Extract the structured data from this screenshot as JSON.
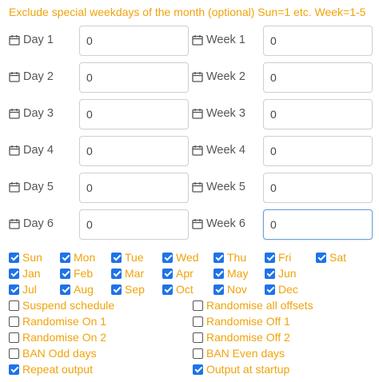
{
  "header": "Exclude special weekdays of the month (optional) Sun=1 etc. Week=1-5",
  "days": [
    {
      "label": "Day 1",
      "value": "0"
    },
    {
      "label": "Day 2",
      "value": "0"
    },
    {
      "label": "Day 3",
      "value": "0"
    },
    {
      "label": "Day 4",
      "value": "0"
    },
    {
      "label": "Day 5",
      "value": "0"
    },
    {
      "label": "Day 6",
      "value": "0"
    }
  ],
  "weeks": [
    {
      "label": "Week 1",
      "value": "0"
    },
    {
      "label": "Week 2",
      "value": "0"
    },
    {
      "label": "Week 3",
      "value": "0"
    },
    {
      "label": "Week 4",
      "value": "0"
    },
    {
      "label": "Week 5",
      "value": "0"
    },
    {
      "label": "Week 6",
      "value": "0"
    }
  ],
  "weekdays": [
    {
      "label": "Sun",
      "checked": true
    },
    {
      "label": "Mon",
      "checked": true
    },
    {
      "label": "Tue",
      "checked": true
    },
    {
      "label": "Wed",
      "checked": true
    },
    {
      "label": "Thu",
      "checked": true
    },
    {
      "label": "Fri",
      "checked": true
    },
    {
      "label": "Sat",
      "checked": true
    }
  ],
  "months_row1": [
    {
      "label": "Jan",
      "checked": true
    },
    {
      "label": "Feb",
      "checked": true
    },
    {
      "label": "Mar",
      "checked": true
    },
    {
      "label": "Apr",
      "checked": true
    },
    {
      "label": "May",
      "checked": true
    },
    {
      "label": "Jun",
      "checked": true
    }
  ],
  "months_row2": [
    {
      "label": "Jul",
      "checked": true
    },
    {
      "label": "Aug",
      "checked": true
    },
    {
      "label": "Sep",
      "checked": true
    },
    {
      "label": "Oct",
      "checked": true
    },
    {
      "label": "Nov",
      "checked": true
    },
    {
      "label": "Dec",
      "checked": true
    }
  ],
  "options": [
    {
      "label": "Suspend schedule",
      "checked": false
    },
    {
      "label": "Randomise all offsets",
      "checked": false
    },
    {
      "label": "Randomise On 1",
      "checked": false
    },
    {
      "label": "Randomise Off 1",
      "checked": false
    },
    {
      "label": "Randomise On 2",
      "checked": false
    },
    {
      "label": "Randomise Off 2",
      "checked": false
    },
    {
      "label": "BAN Odd days",
      "checked": false
    },
    {
      "label": "BAN Even days",
      "checked": false
    },
    {
      "label": "Repeat output",
      "checked": true
    },
    {
      "label": "Output at startup",
      "checked": true
    }
  ],
  "colors": {
    "accent": "#f0a30a",
    "check": "#1e73e8",
    "label": "#555555"
  },
  "icons": {
    "field_icon": "calendar-icon"
  }
}
